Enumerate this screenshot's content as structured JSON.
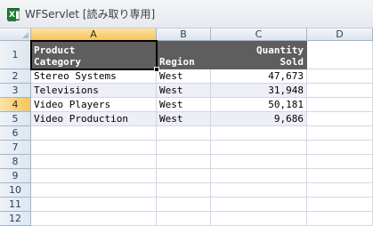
{
  "window": {
    "title": "WFServlet [読み取り専用]",
    "icon": "excel-icon"
  },
  "columns": [
    "A",
    "B",
    "C",
    "D"
  ],
  "rows": [
    "1",
    "2",
    "3",
    "4",
    "5",
    "6",
    "7",
    "8",
    "9",
    "10",
    "11",
    "12"
  ],
  "header": {
    "product_category": "Product\nCategory",
    "region": "Region",
    "quantity_sold": "Quantity\nSold"
  },
  "data_rows": [
    {
      "category": "Stereo Systems",
      "region": "West",
      "quantity": "47,673"
    },
    {
      "category": "Televisions",
      "region": "West",
      "quantity": "31,948"
    },
    {
      "category": "Video Players",
      "region": "West",
      "quantity": "50,181"
    },
    {
      "category": "Video Production",
      "region": "West",
      "quantity": "9,686"
    }
  ],
  "selection": {
    "active_column": "A",
    "active_row": "4"
  },
  "colors": {
    "header_fill": "#5e5e5e",
    "band_fill": "#eeeef6",
    "selected_header": "#f7c45b",
    "gridline": "#d0d7e5"
  }
}
